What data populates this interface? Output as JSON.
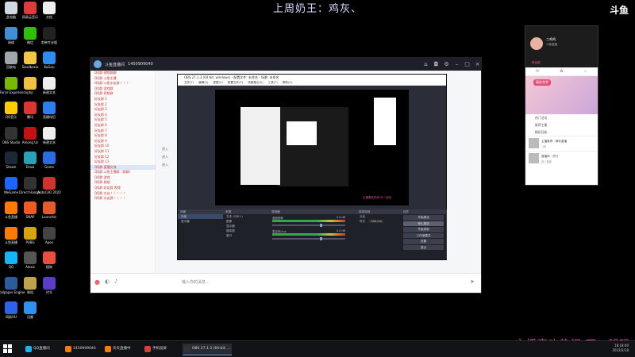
{
  "overlay": {
    "top_title": "上周奶王：鸡灰、",
    "corner_logo": "斗鱼",
    "bottom_banner": "主播喜欢热闹 可一起玩"
  },
  "desktop_icons": [
    {
      "label": "此电脑",
      "color": "#cfd8e3"
    },
    {
      "label": "网易云音乐",
      "color": "#e03b3b"
    },
    {
      "label": "文档",
      "color": "#eeeeee"
    },
    {
      "label": "网络",
      "color": "#3d8fd9"
    },
    {
      "label": "微信",
      "color": "#2dc100"
    },
    {
      "label": "剪映专业版",
      "color": "#222222"
    },
    {
      "label": "回收站",
      "color": "#a0a6ad"
    },
    {
      "label": "Sandboxie",
      "color": "#f3c744"
    },
    {
      "label": "KuGou",
      "color": "#2d8cf0"
    },
    {
      "label": "GeForce Experience",
      "color": "#76b900"
    },
    {
      "label": "php",
      "color": "#f0c040"
    },
    {
      "label": "新建文本",
      "color": "#eeeeee"
    },
    {
      "label": "QQ音乐",
      "color": "#ffcc00"
    },
    {
      "label": "腾讯",
      "color": "#d33"
    },
    {
      "label": "直播伴侣",
      "color": "#2d7ef0"
    },
    {
      "label": "OBS Studio",
      "color": "#333333"
    },
    {
      "label": "Among Us",
      "color": "#c51111"
    },
    {
      "label": "新建文本",
      "color": "#eeeeee"
    },
    {
      "label": "Steam",
      "color": "#1b2838"
    },
    {
      "label": "Draw",
      "color": "#2aa2b5"
    },
    {
      "label": "Game",
      "color": "#2b6ce0"
    },
    {
      "label": "WeGame",
      "color": "#1a66ff"
    },
    {
      "label": "Direct Hanger",
      "color": "#333333"
    },
    {
      "label": "AutoCAD 2020",
      "color": "#d0322c"
    },
    {
      "label": "斗鱼直播",
      "color": "#ff7a00"
    },
    {
      "label": "SNAP",
      "color": "#ef5a24"
    },
    {
      "label": "LaunchIn",
      "color": "#e45c2b"
    },
    {
      "label": "斗鱼直播",
      "color": "#ff7a00"
    },
    {
      "label": "PUBG",
      "color": "#d5a40a"
    },
    {
      "label": "Apex",
      "color": "#444444"
    },
    {
      "label": "QQ",
      "color": "#12b7f5"
    },
    {
      "label": "Alexis",
      "color": "#555555"
    },
    {
      "label": "搜狗",
      "color": "#e94f3d"
    },
    {
      "label": "Wallpaper Engine",
      "color": "#2d5c9a"
    },
    {
      "label": "咪咕",
      "color": "#bfa24c"
    },
    {
      "label": "代号",
      "color": "#5a3ec8"
    },
    {
      "label": "网易UU",
      "color": "#2e62e8"
    },
    {
      "label": "迅雷",
      "color": "#2f8ff2"
    }
  ],
  "chat": {
    "window_title": "斗鱼直播间",
    "tab_label": "1450909040",
    "sidebar_rows": [
      "QQ群 视频群聊",
      "QQ群 斗鱼主播",
      "QQ群 斗鱼水友群 ！！！",
      "QQ群 游戏群",
      "QQ群 视频群",
      "好友群 1",
      "好友群 2",
      "好友群 3",
      "好友群 4",
      "好友群 5",
      "好友群 6",
      "好友群 7",
      "好友群 8",
      "好友群 9",
      "好友群 10",
      "好友群 11",
      "好友群 12",
      "好友群 13",
      "QQ群 直播交流",
      "QQ群 斗鱼主播群（群聊）",
      "QQ群 游戏",
      "QQ群 群组",
      "QQ群 好友群 视频",
      "QQ群 水友 ！！！！！",
      "QQ群 水友群 ！！！！"
    ],
    "messages": [
      "进入",
      "进入",
      "进入"
    ],
    "input_placeholder": "输入你的消息..."
  },
  "obs": {
    "title": "OBS 27.1.3 (64-bit, windows) - 配置文件: 未命名 - 场景: 未命名",
    "menu": [
      "文件(F)",
      "编辑(E)",
      "视图(V)",
      "配置文件(P)",
      "场景集合(S)",
      "工具(T)",
      "帮助(H)"
    ],
    "docks": {
      "scenes": {
        "header": "场景",
        "items": [
          "场景",
          "显示器"
        ]
      },
      "sources": {
        "header": "来源",
        "items": [
          "文本 (GDI+)",
          "图像",
          "显示器",
          "媒体源",
          "窗口"
        ]
      },
      "mixer": {
        "header": "混音器",
        "channels": [
          "桌面音频",
          "麦克风/Aux"
        ],
        "level_db": "0.0 dB"
      },
      "transitions": {
        "header": "转场特效",
        "type": "淡出",
        "duration_label": "时长",
        "duration": "300 ms"
      },
      "controls": {
        "header": "控件",
        "buttons": [
          "开始推流",
          "停止推流",
          "开始录制",
          "工作室模式",
          "设置",
          "退出"
        ],
        "active_index": 1
      }
    },
    "live_text": "LIVE: 00:00:00",
    "status": "CPU: 3.0%, 60.00 fps"
  },
  "phone": {
    "streamer_name": "二鸡鸡",
    "sub": "斗鱼直播",
    "badge": "粉丝团",
    "banner_label": "精彩世界",
    "rows": [
      "热门活动",
      "推荐主播",
      "精彩回放"
    ],
    "cards": [
      {
        "title": "主播推荐 · 精彩直播",
        "sub": "斗鱼"
      },
      {
        "title": "直播间 · 热门",
        "sub": "进入直播"
      }
    ]
  },
  "taskbar": {
    "items": [
      "QQ直播间",
      "1450909040",
      "天天直播中",
      "手机投屏",
      "OBS 27.1.3 (64-bit, ..."
    ],
    "active_index": 4,
    "time": "18:18:00",
    "date": "2022/2/18"
  }
}
